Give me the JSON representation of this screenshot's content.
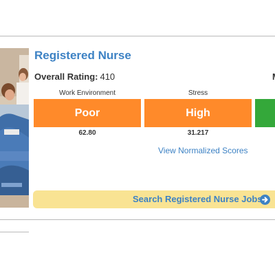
{
  "job": {
    "title": "Registered Nurse",
    "overall_label": "Overall Rating:",
    "overall_value": "410",
    "next_label_clipped": "M"
  },
  "metrics": [
    {
      "label": "Work Environment",
      "rating": "Poor",
      "score": "62.80",
      "color": "#ff8a2a"
    },
    {
      "label": "Stress",
      "rating": "High",
      "score": "31.217",
      "color": "#ff8a2a"
    },
    {
      "label": "",
      "rating": "",
      "score": "",
      "color": "#34a83a"
    }
  ],
  "links": {
    "view_normalized": "View Normalized Scores",
    "search_jobs": "Search Registered Nurse Jobs"
  },
  "colors": {
    "accent_blue": "#3d82c4",
    "search_bg": "#f9e393",
    "orange": "#ff8a2a",
    "green": "#34a83a"
  },
  "icons": {
    "search_arrow": "circle-arrow-right-icon"
  }
}
